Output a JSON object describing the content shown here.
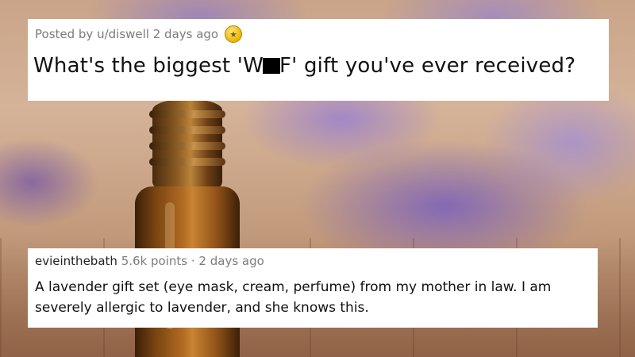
{
  "post": {
    "posted_by": "Posted by u/diswell 2 days ago",
    "title_before": "What's the biggest 'W",
    "title_after": "F' gift you've ever received?",
    "award_icon": "award-icon"
  },
  "comment": {
    "username": "evieinthebath",
    "points": "5.6k points",
    "separator": "·",
    "time": "2 days ago",
    "body": "A lavender gift set (eye mask, cream, perfume) from my mother in law. I am severely allergic to lavender, and she knows this."
  }
}
